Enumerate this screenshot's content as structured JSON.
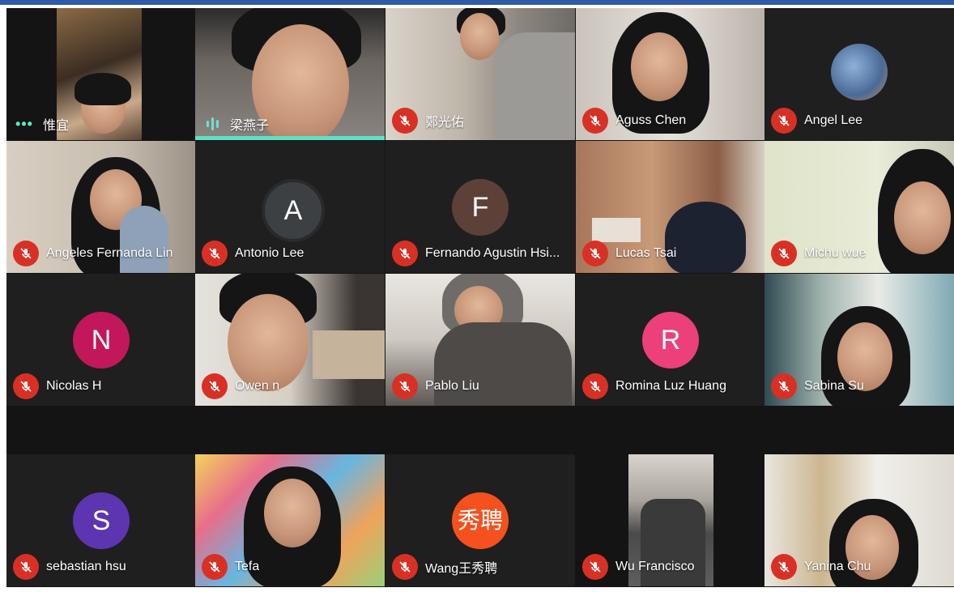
{
  "colors": {
    "muted_mic": "#d93025",
    "speaking": "#5fe0c7",
    "window_border": "#2e5aa8",
    "grid_bg": "#141414"
  },
  "participants": [
    {
      "name": "惟宜",
      "status": "more-options"
    },
    {
      "name": "梁燕子",
      "status": "speaking"
    },
    {
      "name": "鄭光佑",
      "status": "muted"
    },
    {
      "name": "Aguss Chen",
      "status": "muted"
    },
    {
      "name": "Angel Lee",
      "status": "muted",
      "avatar": "photo"
    },
    {
      "name": "Angeles Fernanda Lin",
      "status": "muted"
    },
    {
      "name": "Antonio Lee",
      "status": "muted",
      "initial": "A",
      "avatar_color": "#3c4043"
    },
    {
      "name": "Fernando Agustin Hsi...",
      "status": "muted",
      "initial": "F",
      "avatar_color": "#5d4037"
    },
    {
      "name": "Lucas Tsai",
      "status": "muted"
    },
    {
      "name": "Michu wue",
      "status": "muted"
    },
    {
      "name": "Nicolas H",
      "status": "muted",
      "initial": "N",
      "avatar_color": "#c2185b"
    },
    {
      "name": "Owen n",
      "status": "muted"
    },
    {
      "name": "Pablo Liu",
      "status": "muted"
    },
    {
      "name": "Romina Luz Huang",
      "status": "muted",
      "initial": "R",
      "avatar_color": "#ec407a"
    },
    {
      "name": "Sabina Su",
      "status": "muted"
    },
    {
      "name": "sebastian hsu",
      "status": "muted",
      "initial": "S",
      "avatar_color": "#5e35b1"
    },
    {
      "name": "Tefa",
      "status": "muted"
    },
    {
      "name": "Wang王秀聘",
      "status": "muted",
      "initial": "秀聘",
      "avatar_color": "#f4511e"
    },
    {
      "name": "Wu Francisco",
      "status": "muted"
    },
    {
      "name": "Yanina Chu",
      "status": "muted"
    }
  ]
}
